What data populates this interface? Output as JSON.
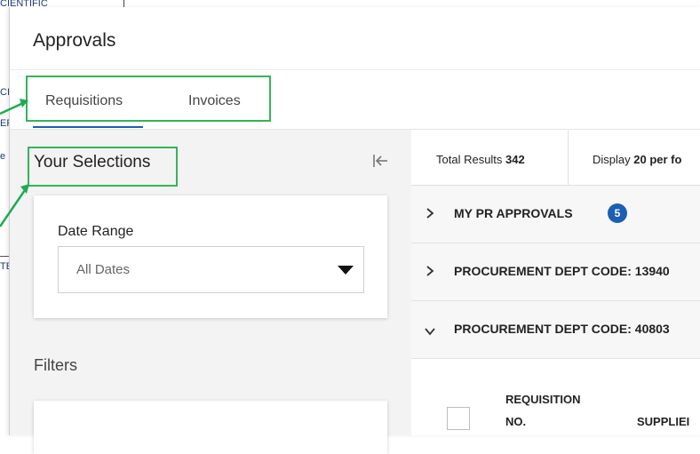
{
  "background": {
    "fragments": [
      "CIENTIFIC",
      "CI",
      "EF",
      "e",
      "TE"
    ]
  },
  "approvals": {
    "title": "Approvals",
    "tabs": [
      {
        "label": "Requisitions",
        "active": true
      },
      {
        "label": "Invoices",
        "active": false
      }
    ]
  },
  "selections": {
    "title": "Your Selections",
    "collapse_icon": "collapse-left-icon",
    "date_range": {
      "label": "Date Range",
      "value": "All Dates"
    }
  },
  "filters": {
    "title": "Filters"
  },
  "results": {
    "total_label": "Total Results",
    "total_value": "342",
    "display_label": "Display",
    "display_value": "20 per fo"
  },
  "groups": [
    {
      "label": "MY PR APPROVALS",
      "count": "5",
      "expanded": false
    },
    {
      "label": "PROCUREMENT DEPT CODE: 13940",
      "expanded": false
    },
    {
      "label": "PROCUREMENT DEPT CODE: 40803",
      "expanded": true
    }
  ],
  "table": {
    "columns": [
      {
        "line1": "REQUISITION",
        "line2": "NO."
      },
      {
        "line1": "",
        "line2": "SUPPLIEI"
      }
    ]
  },
  "colors": {
    "accent": "#1a5fb4",
    "highlight": "#35b35a"
  }
}
